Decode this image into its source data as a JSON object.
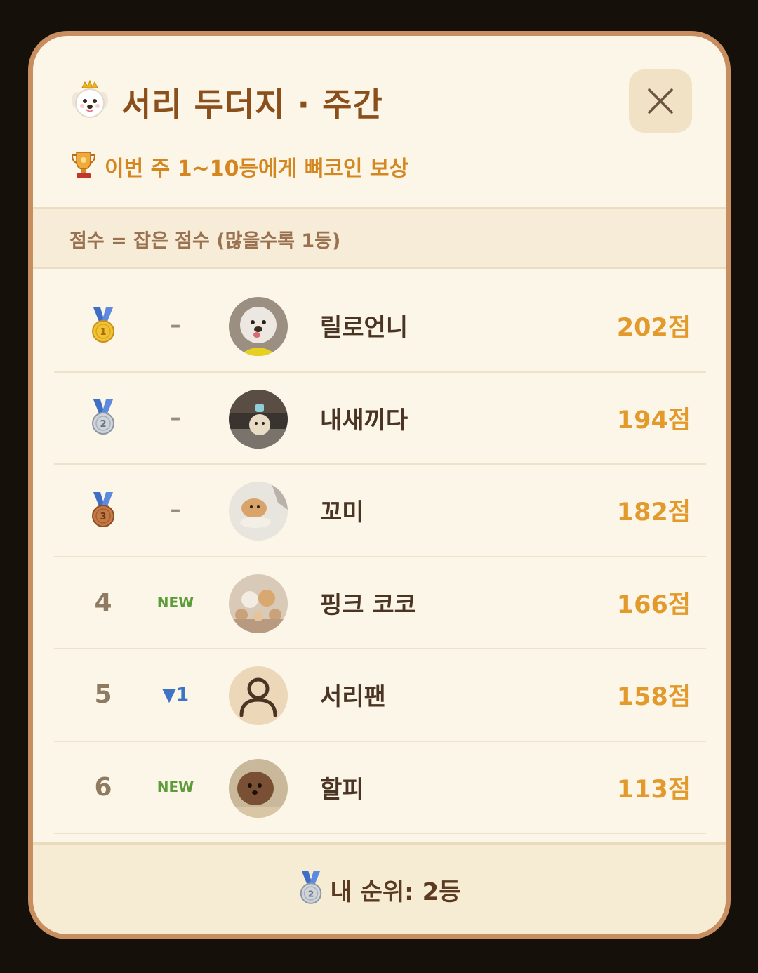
{
  "header": {
    "title": "서리 두더지 · 주간",
    "title_icon": "puppy-crown-icon",
    "subtitle": "이번 주 1~10등에게 뼈코인 보상",
    "subtitle_icon": "trophy-icon",
    "close_icon": "close-icon"
  },
  "score_info": "점수 = 잡은 점수 (많을수록 1등)",
  "leaderboard": [
    {
      "rank": "1",
      "medal": "gold-medal-icon",
      "change": "–",
      "change_type": "same",
      "avatar": "dog-photo-avatar",
      "name": "릴로언니",
      "score": "202점"
    },
    {
      "rank": "2",
      "medal": "silver-medal-icon",
      "change": "–",
      "change_type": "same",
      "avatar": "dog-photo-avatar",
      "name": "내새끼다",
      "score": "194점"
    },
    {
      "rank": "3",
      "medal": "bronze-medal-icon",
      "change": "–",
      "change_type": "same",
      "avatar": "dog-photo-avatar",
      "name": "꼬미",
      "score": "182점"
    },
    {
      "rank": "4",
      "medal": "",
      "change": "NEW",
      "change_type": "new",
      "avatar": "dog-photo-avatar",
      "name": "핑크 코코",
      "score": "166점"
    },
    {
      "rank": "5",
      "medal": "",
      "change": "▼1",
      "change_type": "down",
      "avatar": "default-user-avatar",
      "name": "서리팬",
      "score": "158점"
    },
    {
      "rank": "6",
      "medal": "",
      "change": "NEW",
      "change_type": "new",
      "avatar": "dog-photo-avatar",
      "name": "할피",
      "score": "113점"
    }
  ],
  "footer": {
    "icon": "silver-medal-icon",
    "my_rank_text": "내 순위: 2등"
  },
  "colors": {
    "title": "#8a4f1b",
    "subtitle": "#d4861f",
    "score": "#e39a2c",
    "border": "#c98e5f",
    "background": "#fcf6e8"
  }
}
